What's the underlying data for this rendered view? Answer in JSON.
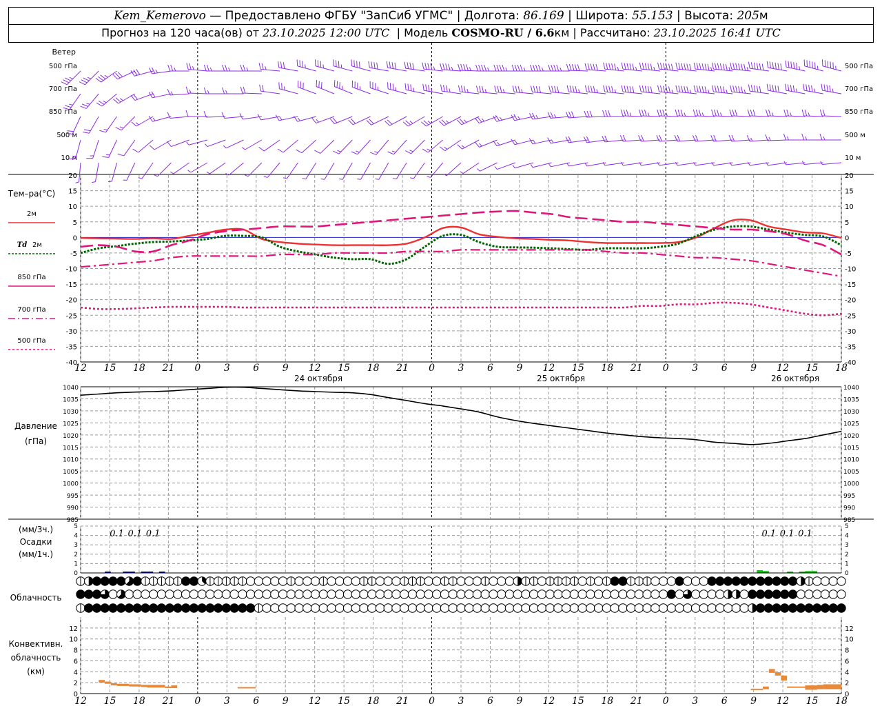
{
  "header": {
    "station": "Kem_Kemerovo",
    "provider": "— Предоставлено ФГБУ \"ЗапСиб УГМС\"",
    "lon_label": "Долгота:",
    "lon": "86.169",
    "lat_label": "Широта:",
    "lat": "55.153",
    "alt_label": "Высота:",
    "alt": "205",
    "alt_unit": "м",
    "forecast_label": "Прогноз на 120 часа(ов) от",
    "forecast_time": "23.10.2025 12:00 UTC",
    "model_label": "Модель",
    "model": "COSMO-RU / 6.6",
    "model_unit": "км",
    "calc_label": "Рассчитано:",
    "calc_time": "23.10.2025 16:41 UTC"
  },
  "labels": {
    "wind": "Ветер",
    "wind_levels": [
      "500 гПа",
      "700 гПа",
      "850 гПа",
      "500 м",
      "10 м"
    ],
    "temp": "Тем–ра(°C)",
    "legend": [
      "2м",
      "2м",
      "850 гПа",
      "700 гПа",
      "500 гПа"
    ],
    "legend_td": "Td",
    "pressure": "Давление",
    "pressure_unit": "(гПа)",
    "precip_top": "(мм/3ч.)",
    "precip": "Осадки",
    "precip_bottom": "(мм/1ч.)",
    "cloud": "Облачность",
    "conv1": "Конвективн.",
    "conv2": "облачность",
    "conv3": "(км)"
  },
  "colors": {
    "wind": "#8b2be2",
    "t2m": "#ee3030",
    "td2m": "#006400",
    "t850": "#e0157c",
    "t700": "#e0157c",
    "t500": "#e0157c",
    "pressure": "#000000",
    "precip_blue": "#0000cc",
    "precip_green": "#00cc00",
    "convective": "#e8893a"
  },
  "chart_data": [
    {
      "type": "line",
      "name": "temperature",
      "x_hours": [
        0,
        3,
        6,
        9,
        12,
        15,
        18,
        21,
        24,
        27,
        30,
        33,
        36,
        39,
        42,
        45,
        48,
        51,
        54,
        57,
        60,
        63,
        66,
        69,
        72,
        75,
        78,
        81,
        84,
        87,
        90,
        93,
        96,
        99,
        102,
        105,
        108,
        111,
        114,
        117,
        120,
        123,
        126
      ],
      "xticks": [
        "12",
        "15",
        "18",
        "21",
        "0",
        "3",
        "6",
        "9",
        "12",
        "15",
        "18",
        "21",
        "0",
        "3",
        "6",
        "9",
        "12",
        "15",
        "18",
        "21",
        "0",
        "3",
        "6",
        "9",
        "12",
        "15",
        "18"
      ],
      "dates": [
        "24 октября",
        "25 октября",
        "26 октября"
      ],
      "ylim": [
        -40,
        20
      ],
      "yticks": [
        20,
        15,
        10,
        5,
        0,
        -5,
        -10,
        -15,
        -20,
        -25,
        -30,
        -35,
        -40
      ],
      "series": [
        {
          "name": "2м",
          "values": [
            -0.2,
            -0.3,
            -0.4,
            -0.5,
            -0.3,
            -0.5,
            0.5,
            1.5,
            2.5,
            2.5,
            -0.5,
            -1.5,
            -2.0,
            -2.3,
            -2.5,
            -2.5,
            -2.5,
            -2.5,
            -2.0,
            0,
            3.0,
            3.2,
            1.0,
            0.2,
            -0.3,
            -0.5,
            -0.8,
            -1.0,
            -1.5,
            -1.8,
            -1.8,
            -1.8,
            -1.8,
            -1.5,
            0,
            3.0,
            5.5,
            5.5,
            3.5,
            2.5,
            1.6,
            1.3,
            -0.2
          ]
        },
        {
          "name": "Td 2м",
          "values": [
            -5.0,
            -3.5,
            -2.8,
            -2.0,
            -1.5,
            -1.3,
            -1.0,
            -0.5,
            0.5,
            0.5,
            0,
            -3.0,
            -4.5,
            -5.5,
            -6.5,
            -7.0,
            -7.0,
            -8.5,
            -7.0,
            -3.0,
            0.5,
            0.8,
            -1.5,
            -3.0,
            -3.2,
            -3.3,
            -3.5,
            -3.8,
            -4.0,
            -3.5,
            -3.5,
            -3.5,
            -3.0,
            -2.0,
            0.5,
            2.5,
            3.5,
            3.5,
            2.5,
            1.5,
            0.8,
            0.3,
            -2.5
          ]
        },
        {
          "name": "850 гПа",
          "values": [
            -3.0,
            -2.5,
            -3.0,
            -4.5,
            -4.5,
            -2.5,
            -1.0,
            1.0,
            2.0,
            2.5,
            3.0,
            3.5,
            3.5,
            3.5,
            4.0,
            4.5,
            5.0,
            5.5,
            6.0,
            6.5,
            7.0,
            7.5,
            8.0,
            8.3,
            8.5,
            8.0,
            7.5,
            6.5,
            6.0,
            5.5,
            5.0,
            5.0,
            4.5,
            4.0,
            3.5,
            3.0,
            2.5,
            2.5,
            2.0,
            1.0,
            -1.0,
            -2.5,
            -5.5
          ]
        },
        {
          "name": "700 гПа",
          "values": [
            -9.5,
            -9.0,
            -8.5,
            -8.0,
            -7.5,
            -6.5,
            -6.0,
            -6.0,
            -6.0,
            -6.0,
            -6.0,
            -5.5,
            -5.5,
            -5.5,
            -5.0,
            -5.0,
            -5.0,
            -5.0,
            -4.5,
            -4.5,
            -4.5,
            -4.0,
            -4.0,
            -4.0,
            -4.0,
            -4.0,
            -4.0,
            -4.0,
            -4.0,
            -4.5,
            -5.0,
            -5.0,
            -5.5,
            -6.0,
            -6.5,
            -6.5,
            -7.0,
            -7.5,
            -8.5,
            -9.5,
            -10.5,
            -11.5,
            -12.5
          ]
        },
        {
          "name": "500 гПа",
          "values": [
            -22.5,
            -23.0,
            -23.0,
            -22.8,
            -22.5,
            -22.3,
            -22.3,
            -22.3,
            -22.3,
            -22.5,
            -22.5,
            -22.5,
            -22.5,
            -22.5,
            -22.5,
            -22.5,
            -22.5,
            -22.5,
            -22.5,
            -22.5,
            -22.5,
            -22.5,
            -22.5,
            -22.5,
            -22.5,
            -22.5,
            -22.5,
            -22.5,
            -22.5,
            -22.5,
            -22.5,
            -22.0,
            -22.0,
            -21.5,
            -21.5,
            -21.0,
            -21.0,
            -21.5,
            -22.5,
            -23.5,
            -24.5,
            -25.0,
            -24.5
          ]
        }
      ]
    },
    {
      "type": "line",
      "name": "pressure",
      "x_hours": [
        0,
        3,
        6,
        9,
        12,
        15,
        18,
        21,
        24,
        27,
        30,
        33,
        36,
        39,
        42,
        45,
        48,
        51,
        54,
        57,
        60,
        63,
        66,
        69,
        72,
        75,
        78,
        81,
        84,
        87,
        90,
        93,
        96,
        99,
        102,
        105,
        108,
        111,
        114,
        117,
        120,
        123,
        126
      ],
      "ylim": [
        985,
        1040
      ],
      "yticks": [
        1040,
        1035,
        1030,
        1025,
        1020,
        1015,
        1010,
        1005,
        1000,
        995,
        990,
        985
      ],
      "series": [
        {
          "name": "Давление",
          "values": [
            1036.5,
            1037.0,
            1037.5,
            1037.8,
            1038.0,
            1038.3,
            1038.8,
            1039.3,
            1039.8,
            1039.8,
            1039.3,
            1038.8,
            1038.3,
            1038.0,
            1037.7,
            1037.5,
            1036.8,
            1035.5,
            1034.3,
            1033.0,
            1032.0,
            1030.8,
            1029.5,
            1027.5,
            1026.0,
            1024.8,
            1023.8,
            1022.8,
            1021.8,
            1020.8,
            1020.0,
            1019.3,
            1018.8,
            1018.5,
            1018.0,
            1017.0,
            1016.5,
            1016.0,
            1016.5,
            1017.5,
            1018.5,
            1020.0,
            1021.5
          ]
        }
      ]
    },
    {
      "type": "bar",
      "name": "precipitation",
      "ylim": [
        0,
        5
      ],
      "yticks": [
        5,
        4,
        3,
        2,
        1,
        0
      ],
      "labels_3h": [
        {
          "hour": 6,
          "text": "0.1"
        },
        {
          "hour": 9,
          "text": "0.1"
        },
        {
          "hour": 12,
          "text": "0.1"
        },
        {
          "hour": 114,
          "text": "0.1"
        },
        {
          "hour": 117,
          "text": "0.1"
        },
        {
          "hour": 120,
          "text": "0.1"
        }
      ],
      "series": [
        {
          "color": "blue",
          "bars": [
            [
              4,
              0.05
            ],
            [
              7,
              0.1
            ],
            [
              8,
              0.1
            ],
            [
              10,
              0.05
            ],
            [
              11,
              0.05
            ],
            [
              13,
              0.05
            ]
          ]
        },
        {
          "color": "green",
          "bars": [
            [
              112,
              0.3
            ],
            [
              113,
              0.2
            ],
            [
              117,
              0.1
            ],
            [
              119,
              0.1
            ],
            [
              120,
              0.2
            ],
            [
              121,
              0.2
            ]
          ]
        }
      ]
    },
    {
      "type": "table",
      "name": "cloudiness",
      "rows": [
        "24888858222228832222200000200020000220002220022000200042202222020288222000800088888888888420000",
        "88860500000000000000000000000000000000000000000000000000000000000000000008060000440888888000000",
        "28888888888888888888882000000000000000000000000000000000000000000000000000000000000488888888888"
      ]
    },
    {
      "type": "bar",
      "name": "convective_cloud",
      "ylim": [
        0,
        14
      ],
      "yticks": [
        12,
        10,
        8,
        6,
        4,
        2,
        0
      ],
      "bars": [
        {
          "h0": 3,
          "h1": 4,
          "base": 2.0,
          "top": 2.5
        },
        {
          "h0": 4,
          "h1": 5,
          "base": 1.8,
          "top": 2.2
        },
        {
          "h0": 5,
          "h1": 6,
          "base": 1.5,
          "top": 1.9
        },
        {
          "h0": 6,
          "h1": 8,
          "base": 1.4,
          "top": 1.8
        },
        {
          "h0": 8,
          "h1": 10,
          "base": 1.3,
          "top": 1.7
        },
        {
          "h0": 10,
          "h1": 11,
          "base": 1.2,
          "top": 1.6
        },
        {
          "h0": 11,
          "h1": 14,
          "base": 1.1,
          "top": 1.6
        },
        {
          "h0": 14,
          "h1": 15,
          "base": 1.0,
          "top": 1.3
        },
        {
          "h0": 15,
          "h1": 16,
          "base": 1.0,
          "top": 1.5
        },
        {
          "h0": 26,
          "h1": 29,
          "base": 1.1,
          "top": 1.2
        },
        {
          "h0": 111,
          "h1": 113,
          "base": 0.8,
          "top": 0.9
        },
        {
          "h0": 113,
          "h1": 114,
          "base": 0.8,
          "top": 1.3
        },
        {
          "h0": 114,
          "h1": 115,
          "base": 3.8,
          "top": 4.5
        },
        {
          "h0": 115,
          "h1": 116,
          "base": 3.3,
          "top": 3.9
        },
        {
          "h0": 116,
          "h1": 117,
          "base": 2.4,
          "top": 3.3
        },
        {
          "h0": 117,
          "h1": 118,
          "base": 1.2,
          "top": 1.3
        },
        {
          "h0": 118,
          "h1": 120,
          "base": 1.2,
          "top": 1.3
        },
        {
          "h0": 120,
          "h1": 122,
          "base": 0.7,
          "top": 1.5
        },
        {
          "h0": 122,
          "h1": 123,
          "base": 0.8,
          "top": 1.6
        },
        {
          "h0": 123,
          "h1": 126,
          "base": 0.8,
          "top": 1.7
        }
      ]
    },
    {
      "type": "scatter",
      "name": "wind_barbs",
      "levels": [
        "500 гПа",
        "700 гПа",
        "850 гПа",
        "500 м",
        "10 м"
      ],
      "hour_step": 3,
      "direction_deg": [
        [
          225,
          225,
          235,
          245,
          255,
          262,
          270,
          275,
          270,
          270,
          270,
          275,
          280,
          285,
          285,
          285,
          285,
          280,
          280,
          278,
          276,
          274,
          272,
          270,
          270,
          270,
          270,
          270,
          272,
          274,
          276,
          276,
          276,
          276,
          276,
          276,
          276,
          276,
          278,
          280,
          282,
          285,
          285
        ],
        [
          215,
          220,
          230,
          240,
          250,
          258,
          266,
          272,
          270,
          270,
          272,
          278,
          285,
          290,
          292,
          292,
          290,
          288,
          285,
          282,
          280,
          278,
          276,
          275,
          275,
          275,
          275,
          275,
          276,
          276,
          276,
          276,
          276,
          276,
          276,
          276,
          276,
          276,
          278,
          280,
          280,
          280,
          280
        ],
        [
          205,
          210,
          215,
          225,
          240,
          255,
          265,
          270,
          268,
          265,
          262,
          260,
          258,
          255,
          250,
          248,
          245,
          244,
          242,
          240,
          240,
          242,
          245,
          250,
          255,
          258,
          262,
          265,
          266,
          268,
          270,
          272,
          272,
          272,
          272,
          272,
          272,
          272,
          272,
          272,
          272,
          272,
          272
        ],
        [
          195,
          198,
          205,
          215,
          230,
          240,
          250,
          255,
          250,
          245,
          240,
          235,
          230,
          228,
          226,
          224,
          222,
          220,
          222,
          225,
          230,
          236,
          242,
          248,
          252,
          256,
          258,
          260,
          262,
          262,
          264,
          266,
          266,
          266,
          266,
          266,
          266,
          266,
          266,
          268,
          270,
          270,
          270
        ],
        [
          185,
          190,
          195,
          205,
          215,
          225,
          235,
          240,
          235,
          230,
          225,
          220,
          215,
          212,
          210,
          210,
          210,
          210,
          212,
          215,
          220,
          228,
          236,
          244,
          250,
          254,
          256,
          258,
          260,
          260,
          262,
          262,
          262,
          262,
          262,
          262,
          262,
          262,
          262,
          262,
          264,
          265,
          265
        ]
      ],
      "speed_ms": [
        [
          18,
          18,
          17,
          16,
          15,
          14,
          13,
          12,
          12,
          12,
          12,
          13,
          15,
          17,
          18,
          19,
          20,
          20,
          21,
          21,
          22,
          22,
          22,
          22,
          22,
          22,
          23,
          24,
          25,
          26,
          27,
          28,
          29,
          30,
          31,
          32,
          32,
          32,
          31,
          30,
          29,
          28,
          27
        ],
        [
          14,
          14,
          13,
          12,
          11,
          10,
          9,
          9,
          9,
          9,
          10,
          11,
          13,
          15,
          16,
          17,
          18,
          18,
          18,
          18,
          18,
          18,
          18,
          18,
          19,
          19,
          20,
          21,
          22,
          23,
          24,
          25,
          26,
          27,
          28,
          28,
          28,
          27,
          26,
          25,
          24,
          23,
          22
        ],
        [
          10,
          10,
          9,
          8,
          7,
          7,
          6,
          6,
          5,
          5,
          5,
          6,
          7,
          8,
          9,
          10,
          11,
          11,
          11,
          12,
          12,
          12,
          12,
          12,
          12,
          13,
          13,
          14,
          15,
          15,
          16,
          17,
          17,
          18,
          18,
          18,
          17,
          16,
          15,
          14,
          13,
          12,
          11
        ],
        [
          7,
          7,
          7,
          6,
          6,
          5,
          5,
          4,
          4,
          4,
          4,
          5,
          5,
          6,
          6,
          7,
          7,
          7,
          7,
          7,
          7,
          7,
          8,
          8,
          8,
          8,
          9,
          9,
          10,
          10,
          10,
          11,
          11,
          11,
          11,
          10,
          10,
          10,
          9,
          9,
          8,
          8,
          7
        ],
        [
          3,
          3,
          3,
          3,
          2,
          2,
          2,
          2,
          2,
          2,
          2,
          2,
          2,
          2,
          2,
          3,
          3,
          3,
          3,
          3,
          3,
          3,
          3,
          3,
          3,
          3,
          4,
          4,
          4,
          4,
          4,
          4,
          4,
          4,
          4,
          4,
          3,
          3,
          3,
          3,
          3,
          3,
          3
        ]
      ]
    }
  ]
}
